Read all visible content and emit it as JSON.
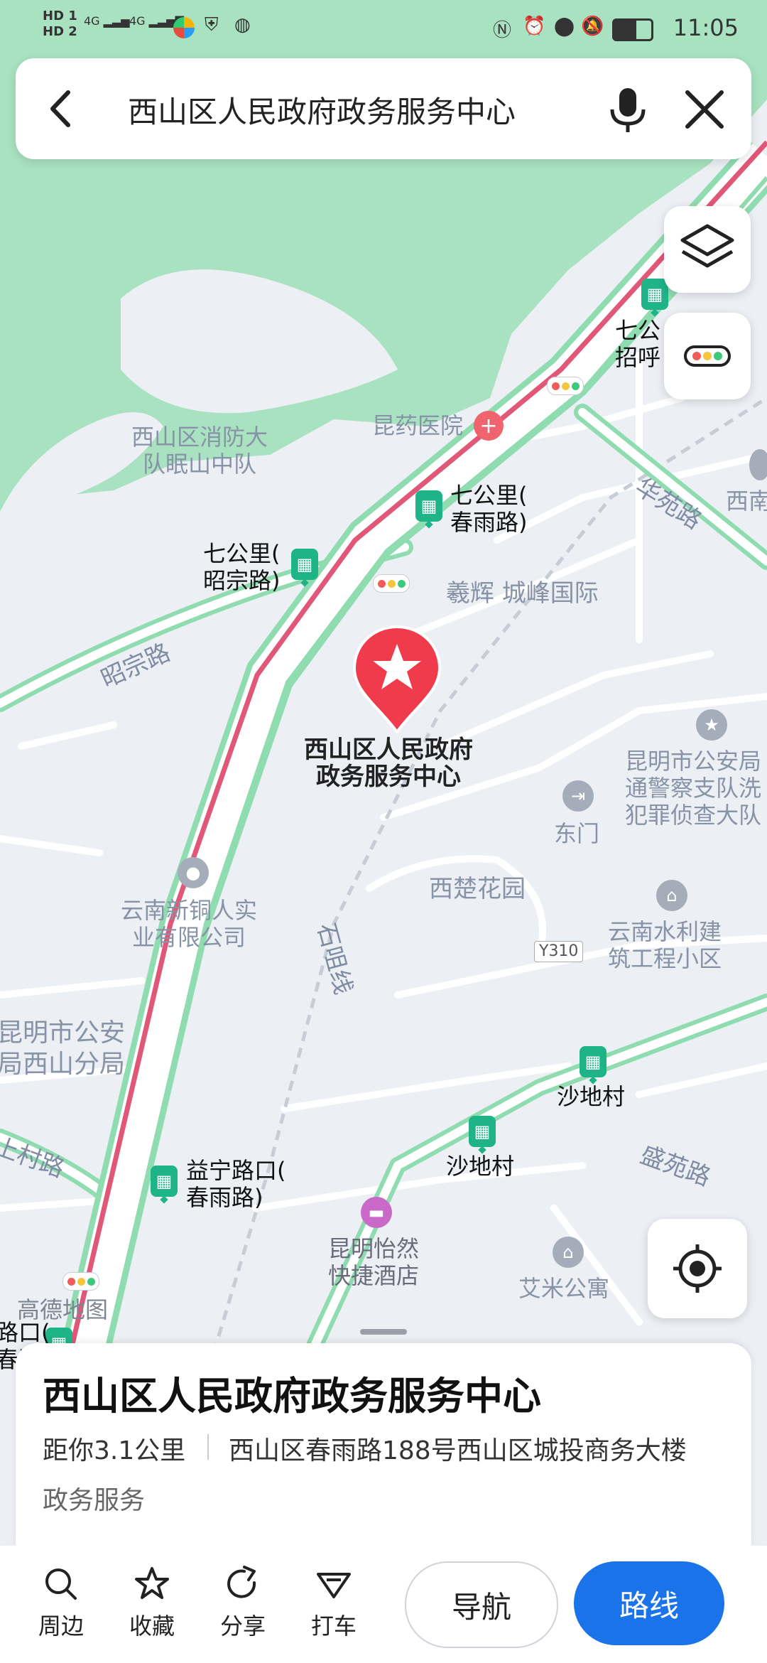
{
  "status_bar": {
    "time": "11:05",
    "left_icons": [
      "hd1-signal-icon",
      "hd2-signal-icon",
      "4g-signal-icon",
      "4g-signal-icon",
      "app-icon",
      "shield-icon",
      "globe-icon"
    ],
    "right_icons": [
      "nfc-icon",
      "alarm-icon",
      "location-icon",
      "mute-icon",
      "battery-icon"
    ],
    "hd1": "HD 1",
    "hd2": "HD 2",
    "net": "4G"
  },
  "search": {
    "query": "西山区人民政府政务服务中心",
    "back_icon": "chevron-left-icon",
    "mic_icon": "microphone-icon",
    "close_icon": "close-icon"
  },
  "map": {
    "destination": {
      "line1": "西山区人民政府",
      "line2": "政务服务中心"
    },
    "labels": {
      "fire_1": "西山区消防大",
      "fire_2": "队眠山中队",
      "hospital": "昆药医院",
      "qgl_chunyu_1": "七公里(",
      "qgl_chunyu_2": "春雨路)",
      "qgl_zhaozong_1": "七公里(",
      "qgl_zhaozong_2": "昭宗路)",
      "qgl_top_1": "七公",
      "qgl_top_2": "招呼",
      "xinan": "西南",
      "huayuan_road": "华苑路",
      "zhaozong_road": "昭宗路",
      "xihui": "羲辉 城峰国际",
      "police_1": "昆明市公安局",
      "police_2": "通警察支队洗",
      "police_3": "犯罪侦查大队",
      "east_gate": "东门",
      "xichu": "西楚花园",
      "tongren_1": "云南新铜人实",
      "tongren_2": "业有限公司",
      "water_1": "云南水利建",
      "water_2": "筑工程小区",
      "y310": "Y310",
      "shiju": "石咀线",
      "km_police_1": "昆明市公安",
      "km_police_2": "局西山分局",
      "shadi_1": "沙地村",
      "shadi_2": "沙地村",
      "shengyuan": "盛苑路",
      "cun_road": "上村路",
      "yining_1": "益宁路口(",
      "yining_2": "春雨路)",
      "hotel_1": "昆明怡然",
      "hotel_2": "快捷酒店",
      "aimi": "艾米公寓",
      "gaode": "高德地图",
      "lukou_1": "路口(",
      "lukou_2": "春路"
    }
  },
  "controls": {
    "layers_icon": "layers-icon",
    "traffic_icon": "traffic-light-icon",
    "locate_icon": "locate-icon"
  },
  "card": {
    "title": "西山区人民政府政务服务中心",
    "distance": "距你3.1公里",
    "address": "西山区春雨路188号西山区城投商务大楼",
    "category": "政务服务"
  },
  "bottom_bar": {
    "nearby": "周边",
    "favorite": "收藏",
    "share": "分享",
    "taxi": "打车",
    "navigate": "导航",
    "route": "路线"
  }
}
